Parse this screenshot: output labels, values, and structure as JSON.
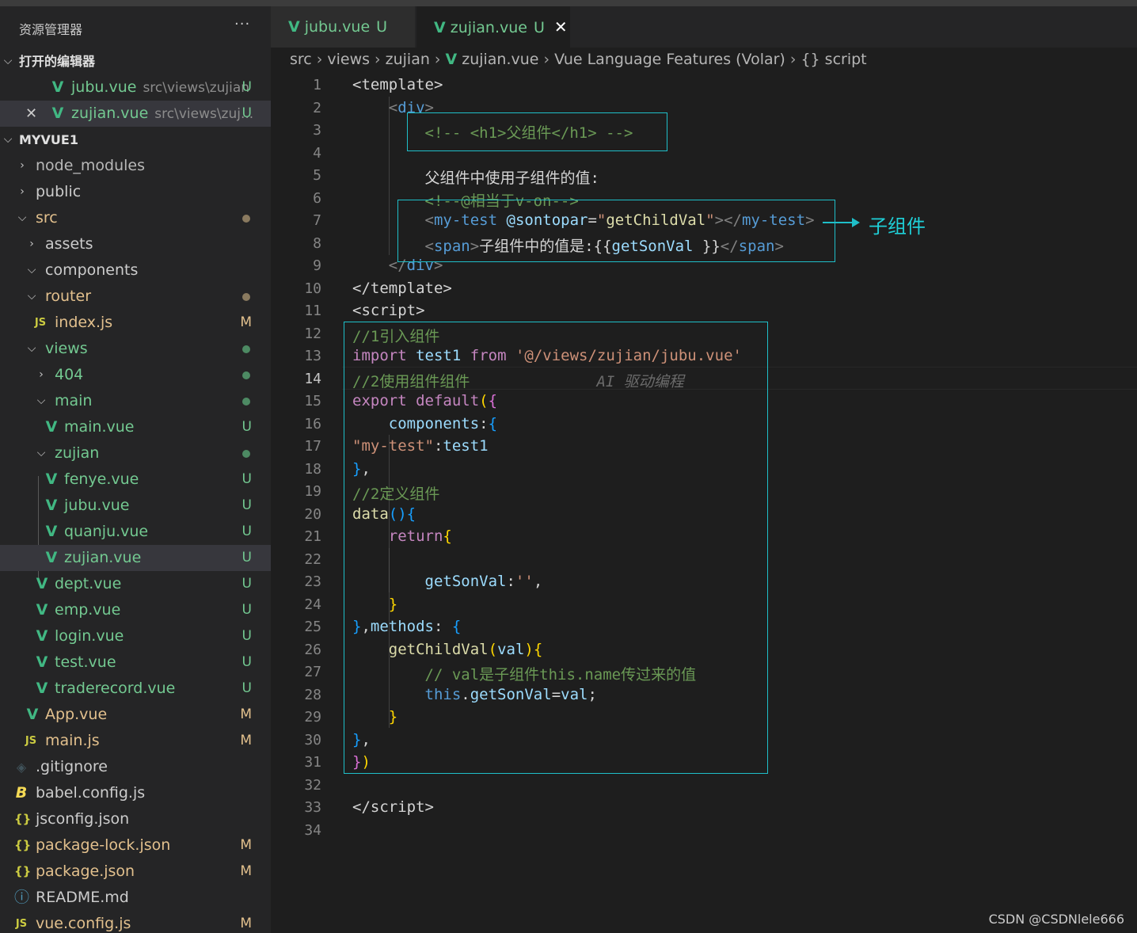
{
  "explorer": {
    "title": "资源管理器",
    "more": "···",
    "open_editors_header": "打开的编辑器",
    "open_editors": [
      {
        "name": "jubu.vue",
        "desc": "src\\views\\zujian",
        "status": "U"
      },
      {
        "name": "zujian.vue",
        "desc": "src\\views\\zuj...",
        "status": "U"
      }
    ],
    "project_header": "MYVUE1",
    "tree": [
      {
        "name": "node_modules"
      },
      {
        "name": "public"
      },
      {
        "name": "src"
      },
      {
        "name": "assets"
      },
      {
        "name": "components"
      },
      {
        "name": "router"
      },
      {
        "name": "index.js",
        "icon": "JS",
        "status": "M"
      },
      {
        "name": "views"
      },
      {
        "name": "404"
      },
      {
        "name": "main"
      },
      {
        "name": "main.vue",
        "status": "U"
      },
      {
        "name": "zujian"
      },
      {
        "name": "fenye.vue",
        "status": "U"
      },
      {
        "name": "jubu.vue",
        "status": "U"
      },
      {
        "name": "quanju.vue",
        "status": "U"
      },
      {
        "name": "zujian.vue",
        "status": "U"
      },
      {
        "name": "dept.vue",
        "status": "U"
      },
      {
        "name": "emp.vue",
        "status": "U"
      },
      {
        "name": "login.vue",
        "status": "U"
      },
      {
        "name": "test.vue",
        "status": "U"
      },
      {
        "name": "traderecord.vue",
        "status": "U"
      },
      {
        "name": "App.vue",
        "status": "M"
      },
      {
        "name": "main.js",
        "icon": "JS",
        "status": "M"
      },
      {
        "name": ".gitignore",
        "icon": "◈"
      },
      {
        "name": "babel.config.js",
        "icon": "B"
      },
      {
        "name": "jsconfig.json",
        "icon": "{}"
      },
      {
        "name": "package-lock.json",
        "icon": "{}",
        "status": "M"
      },
      {
        "name": "package.json",
        "icon": "{}",
        "status": "M"
      },
      {
        "name": "README.md",
        "icon": "ⓘ"
      },
      {
        "name": "vue.config.js",
        "icon": "JS",
        "status": "M"
      }
    ]
  },
  "tabs": [
    {
      "name": "jubu.vue",
      "status": "U"
    },
    {
      "name": "zujian.vue",
      "status": "U",
      "close": "✕"
    }
  ],
  "breadcrumb": [
    "src",
    "views",
    "zujian",
    "zujian.vue",
    "Vue Language Features (Volar)",
    "{} script"
  ],
  "editor": {
    "current_line": 14,
    "lines": [
      "1",
      "2",
      "3",
      "4",
      "5",
      "6",
      "7",
      "8",
      "9",
      "10",
      "11",
      "12",
      "13",
      "14",
      "15",
      "16",
      "17",
      "18",
      "19",
      "20",
      "21",
      "22",
      "23",
      "24",
      "25",
      "26",
      "27",
      "28",
      "29",
      "30",
      "31",
      "32",
      "33",
      "34"
    ]
  },
  "annotation": {
    "label": "子组件"
  },
  "watermark": "CSDN @CSDNlele666",
  "colors": {
    "accent": "#1fbfc9",
    "vue": "#41b883",
    "untracked": "#73c991",
    "modified": "#e2c08d"
  }
}
